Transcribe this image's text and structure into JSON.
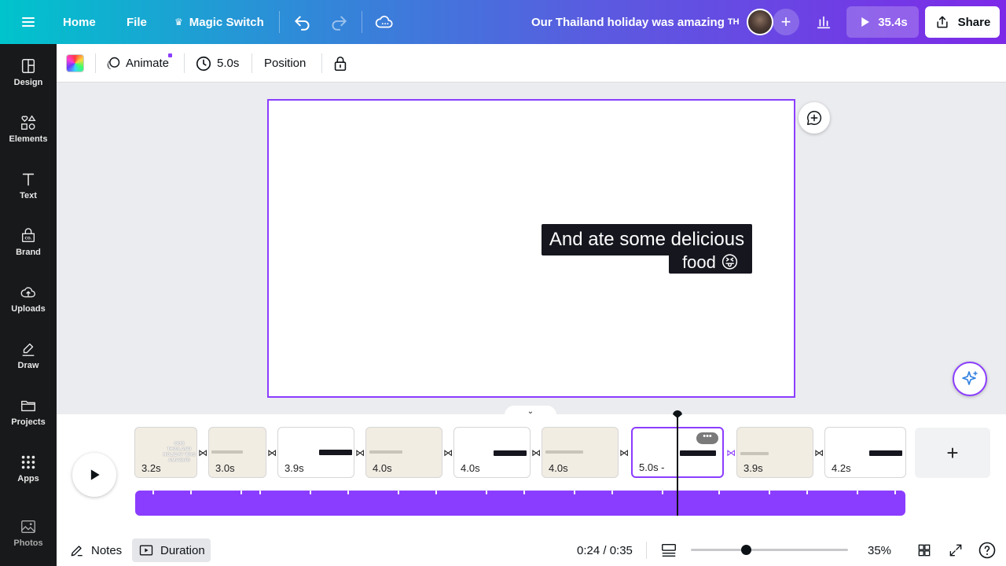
{
  "topbar": {
    "home": "Home",
    "file": "File",
    "magic_switch": "Magic Switch",
    "design_title": "Our Thailand holiday was amazing",
    "title_suffix": "TH",
    "play_duration": "35.4s",
    "share": "Share"
  },
  "sidebar": {
    "items": [
      {
        "label": "Design",
        "icon": "design-icon"
      },
      {
        "label": "Elements",
        "icon": "elements-icon"
      },
      {
        "label": "Text",
        "icon": "text-icon"
      },
      {
        "label": "Brand",
        "icon": "brand-icon"
      },
      {
        "label": "Uploads",
        "icon": "uploads-icon"
      },
      {
        "label": "Draw",
        "icon": "draw-icon"
      },
      {
        "label": "Projects",
        "icon": "projects-icon"
      },
      {
        "label": "Apps",
        "icon": "apps-icon"
      },
      {
        "label": "Photos",
        "icon": "photos-icon"
      }
    ]
  },
  "toolbar": {
    "animate": "Animate",
    "duration": "5.0s",
    "position": "Position"
  },
  "canvas": {
    "caption_line1": "And ate some delicious",
    "caption_line2": "food 😝"
  },
  "timeline": {
    "scenes": [
      {
        "duration": "3.2s",
        "bg": "#f2ede3"
      },
      {
        "duration": "3.0s",
        "bg": "#f2ede3"
      },
      {
        "duration": "3.9s",
        "bg": "#ffffff"
      },
      {
        "duration": "4.0s",
        "bg": "#f2ede3"
      },
      {
        "duration": "4.0s",
        "bg": "#ffffff"
      },
      {
        "duration": "4.0s",
        "bg": "#f2ede3"
      },
      {
        "duration": "5.0s -",
        "bg": "#ffffff"
      },
      {
        "duration": "3.9s",
        "bg": "#f2ede3"
      },
      {
        "duration": "4.2s",
        "bg": "#ffffff"
      }
    ],
    "scene1_text": "OUR THAILAND HOLIDAY WAS AMAZING"
  },
  "bottombar": {
    "notes": "Notes",
    "duration": "Duration",
    "time": "0:24 / 0:35",
    "zoom": "35%",
    "zoom_level": 0.35
  },
  "colors": {
    "accent": "#8b3dff",
    "caption_bg": "#16161f"
  }
}
